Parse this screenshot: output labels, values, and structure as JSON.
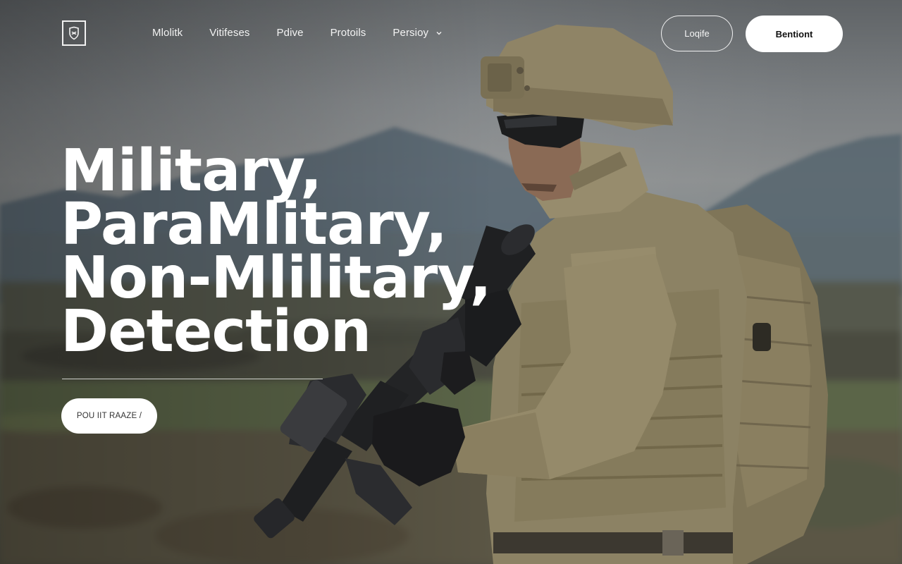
{
  "brand": {
    "logo_icon": "shield-logo-icon"
  },
  "nav": {
    "links": [
      {
        "label": "Mlolitk"
      },
      {
        "label": "Vitifeses"
      },
      {
        "label": "Pdive"
      },
      {
        "label": "Protoils"
      },
      {
        "label": "Persioy",
        "has_dropdown": true,
        "icon": "chevron-down-icon"
      }
    ],
    "login_label": "Loqife",
    "cta_label": "Bentiont"
  },
  "hero": {
    "headline_lines": [
      "Military,",
      "ParaMlitary,",
      "Non-Mlilitary,",
      "Detection"
    ],
    "button_label": "POU IIT RAAZE /"
  },
  "colors": {
    "text_primary": "#ffffff",
    "button_bg": "#ffffff",
    "button_text": "#111111",
    "soldier_uniform": "#8f8567"
  }
}
